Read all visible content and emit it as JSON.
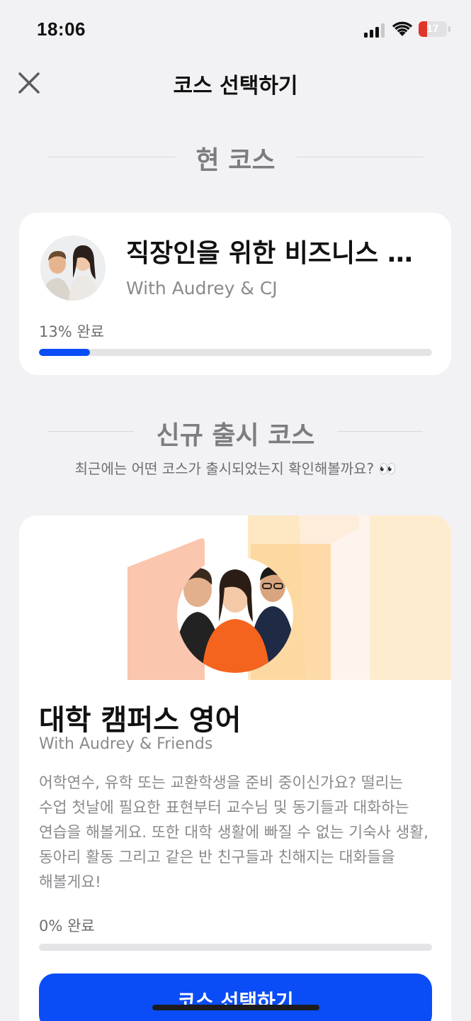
{
  "status_bar": {
    "time": "18:06",
    "battery_level": "17",
    "battery_color": "#e0352b",
    "icons": [
      "signal-icon",
      "wifi-icon",
      "battery-icon"
    ]
  },
  "header": {
    "title": "코스 선택하기",
    "close_icon": "close-icon"
  },
  "current_section": {
    "title": "현 코스",
    "course": {
      "title": "직장인을 위한 비즈니스 영어",
      "instructor": "With Audrey & CJ",
      "progress_label": "13% 완료",
      "progress": 0.13
    }
  },
  "new_section": {
    "title": "신규 출시 코스",
    "subtitle": "최근에는 어떤 코스가 출시되었는지 확인해볼까요? 👀",
    "course": {
      "title": "대학 캠퍼스 영어",
      "instructor": "With Audrey & Friends",
      "description": "어학연수, 유학 또는 교환학생을 준비 중이신가요? 떨리는 수업 첫날에 필요한 표현부터 교수님 및 동기들과 대화하는 연습을 해볼게요. 또한 대학 생활에 빠질 수 없는 기숙사 생활, 동아리 활동 그리고 같은 반 친구들과 친해지는 대화들을 해볼게요!",
      "progress_label": "0% 완료",
      "progress": 0,
      "button_label": "코스 선택하기"
    }
  },
  "colors": {
    "accent": "#0a4df7",
    "background": "#f2f2f4"
  }
}
